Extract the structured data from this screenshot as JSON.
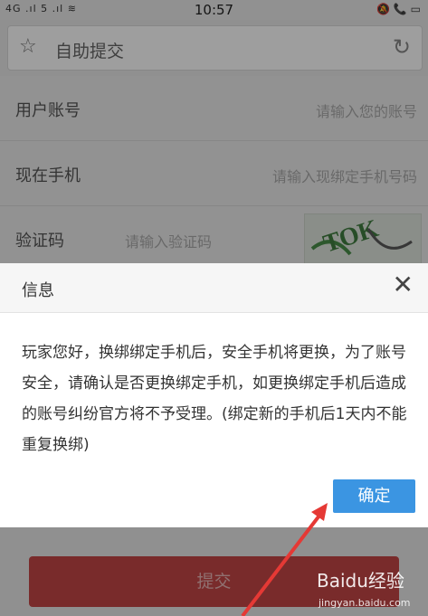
{
  "status_bar": {
    "left": "4G .ıl 5 .ıl  ≋",
    "time": "10:57",
    "right": "🔕 📞 ▭"
  },
  "url_bar": {
    "title": "自助提交",
    "star_icon": "star-icon",
    "refresh_icon": "refresh-icon"
  },
  "form": {
    "rows": [
      {
        "label": "用户账号",
        "placeholder": "请输入您的账号"
      },
      {
        "label": "现在手机",
        "placeholder": "请输入现绑定手机号码"
      },
      {
        "label": "验证码",
        "placeholder": "请输入验证码"
      }
    ],
    "captcha_text": "TOK",
    "submit_label": "提交"
  },
  "dialog": {
    "title": "信息",
    "close_symbol": "✕",
    "message": "玩家您好，换绑绑定手机后，安全手机将更换，为了账号安全，请确认是否更换绑定手机，如更换绑定手机后造成的账号纠纷官方将不予受理。(绑定新的手机后1天内不能重复换绑)",
    "confirm_label": "确定"
  },
  "watermark": {
    "brand": "Baidu经验",
    "url": "jingyan.baidu.com"
  },
  "colors": {
    "confirm": "#3b95e2",
    "submit": "#c44646",
    "arrow": "#e53935"
  }
}
